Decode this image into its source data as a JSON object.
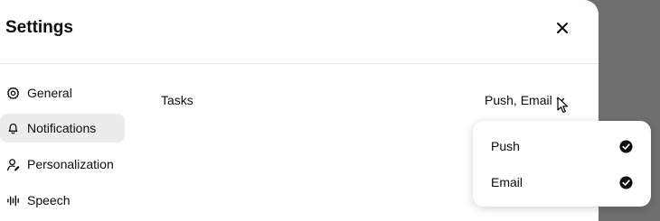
{
  "dialog": {
    "title": "Settings",
    "close_icon": "close-icon"
  },
  "sidebar": {
    "items": [
      {
        "label": "General",
        "icon": "gear-icon",
        "active": false
      },
      {
        "label": "Notifications",
        "icon": "bell-icon",
        "active": true
      },
      {
        "label": "Personalization",
        "icon": "person-icon",
        "active": false
      },
      {
        "label": "Speech",
        "icon": "waveform-icon",
        "active": false
      }
    ]
  },
  "main": {
    "row_label": "Tasks",
    "row_value": "Push, Email"
  },
  "dropdown": {
    "options": [
      {
        "label": "Push",
        "checked": true
      },
      {
        "label": "Email",
        "checked": true
      }
    ]
  }
}
